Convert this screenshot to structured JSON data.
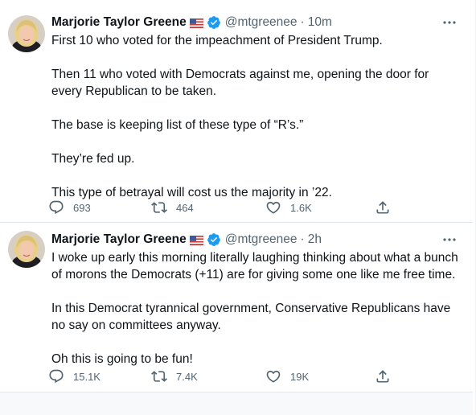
{
  "colors": {
    "text": "#0f1419",
    "secondary": "#536471",
    "verified": "#1d9bf0",
    "divider": "#e1e8ed"
  },
  "tweets": [
    {
      "author_name": "Marjorie Taylor Greene",
      "flag_icon": "us-flag-icon",
      "verified_icon": "verified-badge-icon",
      "handle": "@mtgreenee",
      "separator": "·",
      "time": "10m",
      "paragraphs": [
        "First 10 who voted for the impeachment of President Trump.",
        "Then 11 who voted with Democrats against me, opening the door for every Republican to be taken.",
        "The base is keeping list of these type of “R’s.”",
        "They’re fed up.",
        "This type of betrayal will cost us the majority in ’22."
      ],
      "replies": "693",
      "retweets": "464",
      "likes": "1.6K"
    },
    {
      "author_name": "Marjorie Taylor Greene",
      "flag_icon": "us-flag-icon",
      "verified_icon": "verified-badge-icon",
      "handle": "@mtgreenee",
      "separator": "·",
      "time": "2h",
      "paragraphs": [
        "I woke up early this morning literally laughing thinking about what a bunch of morons the Democrats (+11) are for giving some one like me free time.",
        "In this Democrat tyrannical government, Conservative Republicans have no say on committees anyway.",
        "Oh this is going to be fun!"
      ],
      "replies": "15.1K",
      "retweets": "7.4K",
      "likes": "19K"
    }
  ]
}
